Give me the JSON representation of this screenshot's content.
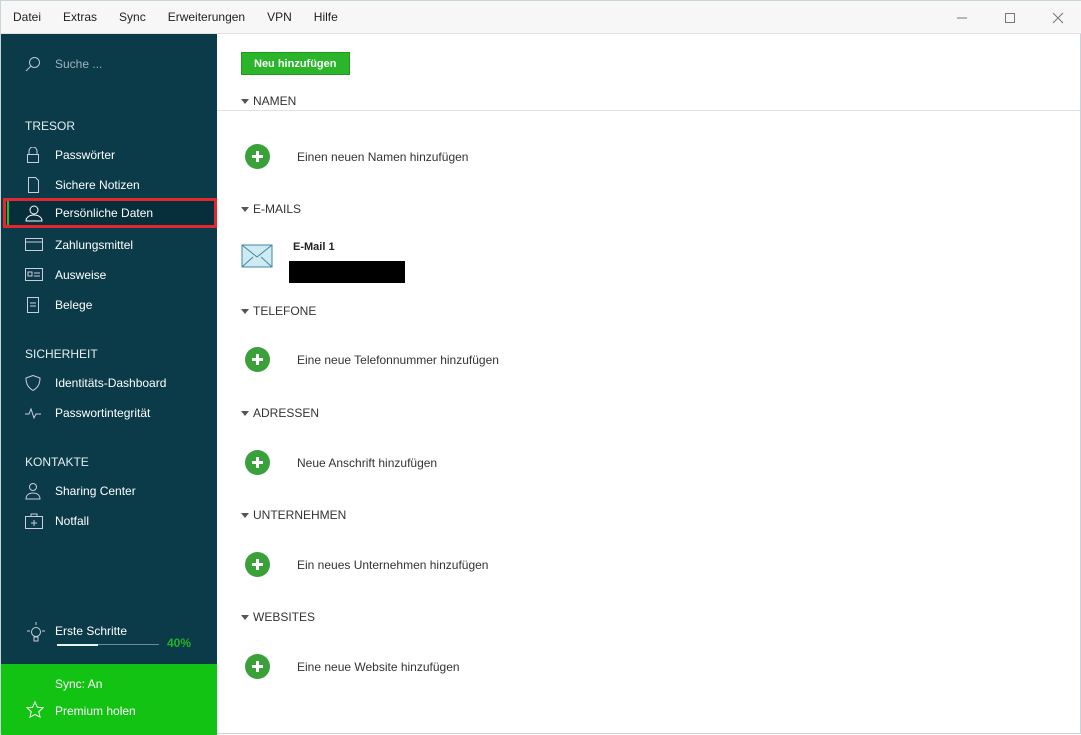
{
  "menu": [
    "Datei",
    "Extras",
    "Sync",
    "Erweiterungen",
    "VPN",
    "Hilfe"
  ],
  "sidebar": {
    "search_placeholder": "Suche ...",
    "sections": {
      "tresor": "TRESOR",
      "sicherheit": "SICHERHEIT",
      "kontakte": "KONTAKTE"
    },
    "items": [
      "Passwörter",
      "Sichere Notizen",
      "Persönliche Daten",
      "Zahlungsmittel",
      "Ausweise",
      "Belege",
      "Identitäts-Dashboard",
      "Passwortintegrität",
      "Sharing Center",
      "Notfall"
    ],
    "active_item": "Persönliche Daten",
    "steps_label": "Erste Schritte",
    "steps_percent_label": "40%",
    "steps_progress": 0.4,
    "sync_status": "Sync: An",
    "premium": "Premium holen"
  },
  "main": {
    "add_button": "Neu hinzufügen",
    "sections": [
      {
        "title": "NAMEN",
        "add": "Einen neuen Namen hinzufügen"
      },
      {
        "title": "E-MAILS",
        "entry": "E-Mail 1"
      },
      {
        "title": "TELEFONE",
        "add": "Eine neue Telefonnummer hinzufügen"
      },
      {
        "title": "ADRESSEN",
        "add": "Neue Anschrift hinzufügen"
      },
      {
        "title": "UNTERNEHMEN",
        "add": "Ein neues Unternehmen hinzufügen"
      },
      {
        "title": "WEBSITES",
        "add": "Eine neue Website hinzufügen"
      }
    ]
  },
  "colors": {
    "sidebar": "#0b3a49",
    "accent": "#13c313",
    "highlight": "#e0282e"
  }
}
